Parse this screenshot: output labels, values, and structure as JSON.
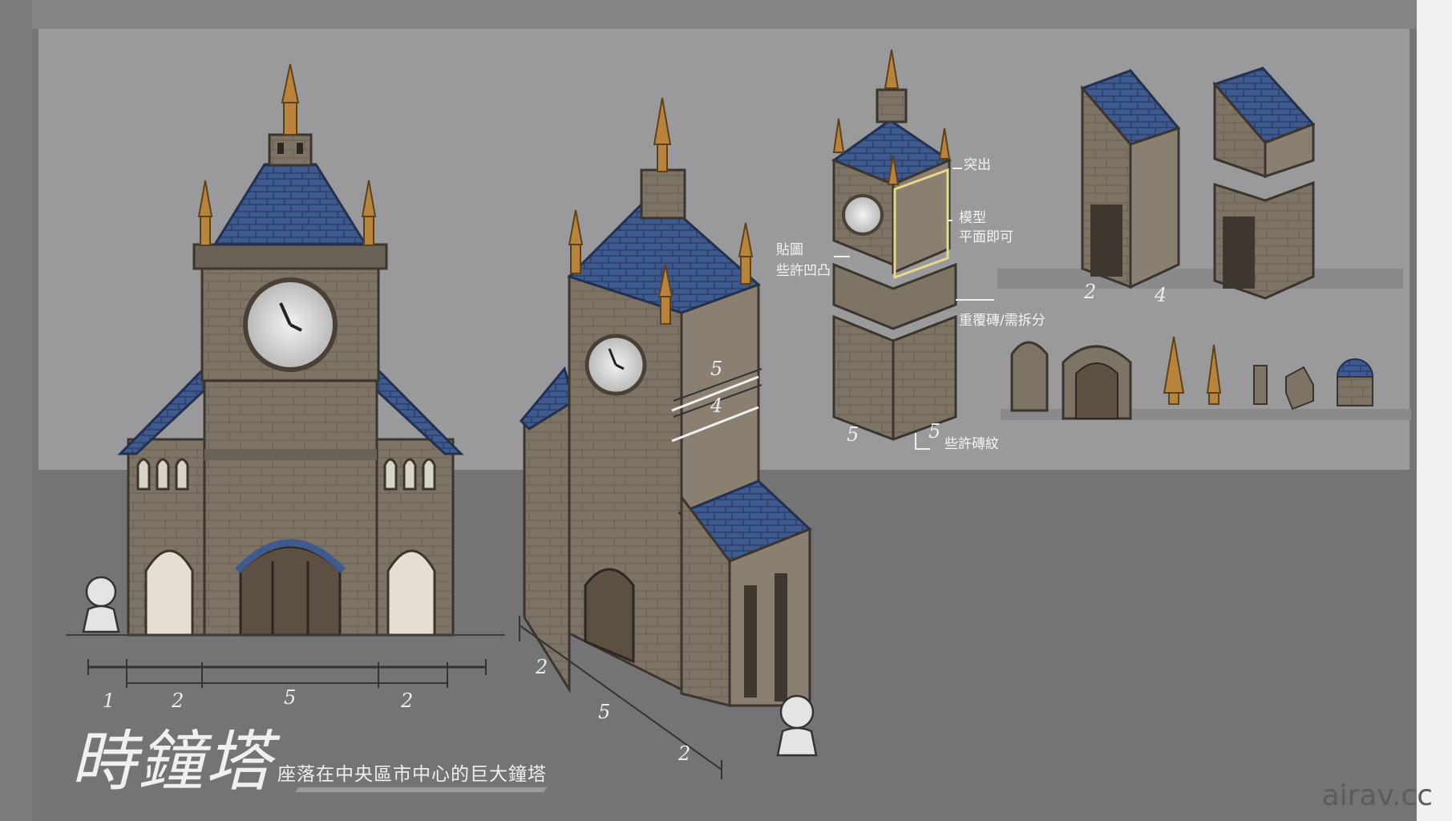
{
  "title": "時鐘塔",
  "subtitle": "座落在中央區市中心的巨大鐘塔",
  "annotations": {
    "protrude": "突出",
    "model_flat_line1": "模型",
    "model_flat_line2": "平面即可",
    "texture_line1": "貼圖",
    "texture_line2": "些許凹凸",
    "repeat_bricks": "重覆磚/需拆分",
    "brick_pattern": "些許磚紋"
  },
  "front_dimensions": [
    "1",
    "2",
    "5",
    "2"
  ],
  "iso_dimensions": [
    "2",
    "5",
    "2"
  ],
  "tower_dimensions": [
    "5",
    "4"
  ],
  "block_dimensions": [
    "5",
    "5"
  ],
  "module_dimensions": [
    "2",
    "4"
  ],
  "watermark": "airav.cc",
  "colors": {
    "roof": "#3f5a8f",
    "stone": "#7d7264",
    "gold": "#b8843c",
    "background": "#9a9a9c"
  }
}
